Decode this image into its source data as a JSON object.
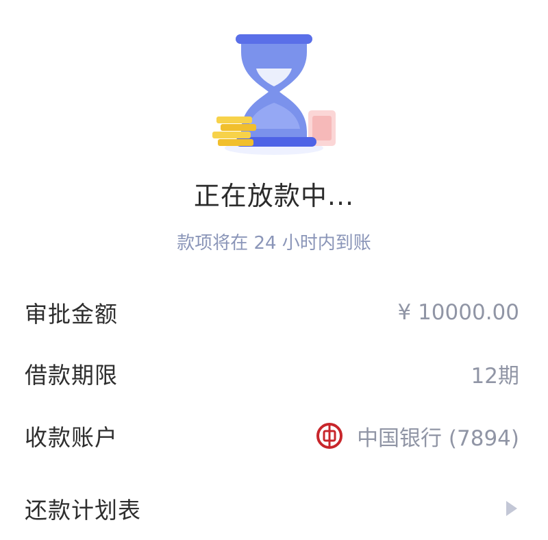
{
  "status": {
    "title": "正在放款中...",
    "subtitle": "款项将在 24 小时内到账"
  },
  "details": [
    {
      "label": "审批金额",
      "value": "¥ 10000.00"
    },
    {
      "label": "借款期限",
      "value": "12期"
    },
    {
      "label": "收款账户",
      "value": "中国银行 (7894)",
      "icon": "bank-of-china-logo"
    },
    {
      "label": "还款计划表",
      "icon": "chevron-right-icon"
    }
  ],
  "colors": {
    "hourglass": "#6f86ea",
    "hourglass_bar": "#4e63e6",
    "coin": "#f6cc3c",
    "bill": "#f8c7c7",
    "bank_red": "#c8262b"
  }
}
